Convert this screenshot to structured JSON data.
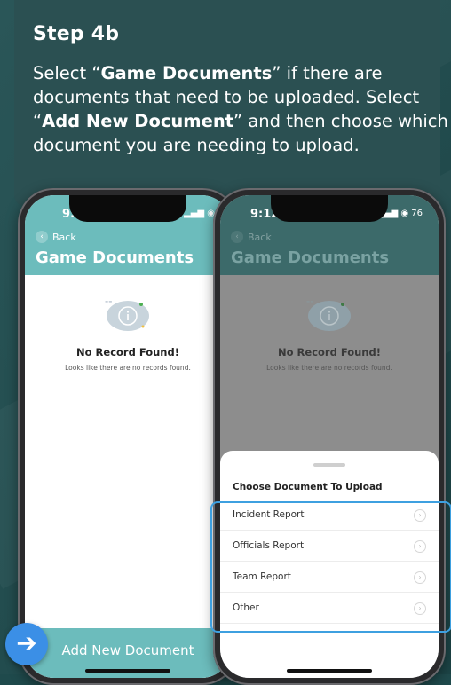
{
  "step": {
    "title": "Step 4b",
    "desc_1": "Select “",
    "desc_bold_1": "Game Documents",
    "desc_2": "” if there are documents that need to be uploaded. Select “",
    "desc_bold_2": "Add New Document",
    "desc_3": "” and then choose which document you are needing to upload."
  },
  "phone_left": {
    "time": "9:12",
    "status_icons": "▂▄▆ ◉",
    "back_label": "Back",
    "title": "Game Documents",
    "empty_title": "No Record Found!",
    "empty_sub": "Looks like there are no records found.",
    "bottom_button": "Add New Document"
  },
  "phone_right": {
    "time": "9:12",
    "status_icons": "▂▄▆ ◉ 76",
    "back_label": "Back",
    "title": "Game Documents",
    "empty_title": "No Record Found!",
    "empty_sub": "Looks like there are no records found.",
    "sheet_title": "Choose Document To Upload",
    "sheet_items": [
      "Incident Report",
      "Officials Report",
      "Team Report",
      "Other"
    ]
  },
  "icons": {
    "back": "‹",
    "chevron": "›",
    "arrow": "➔"
  },
  "colors": {
    "teal": "#6cbcbc",
    "highlight": "#3ea0e0",
    "fab": "#3b8fe6"
  }
}
